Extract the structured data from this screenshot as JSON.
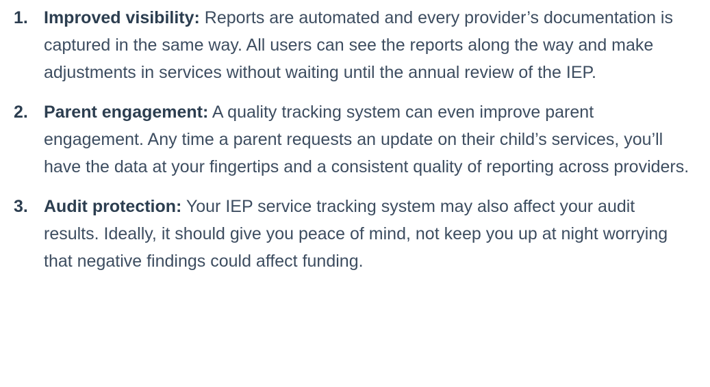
{
  "items": [
    {
      "number": "1.",
      "lead": "Improved visibility:",
      "body": "Reports are automated and every provider’s documentation is captured in the same way. All users can see the reports along the way and make adjustments in services without waiting until the annual review of the IEP."
    },
    {
      "number": "2.",
      "lead": "Parent engagement:",
      "body": "A quality tracking system can even improve parent engagement. Any time a parent requests an update on their child’s services, you’ll have the data at your fingertips and a consistent quality of reporting across providers."
    },
    {
      "number": "3.",
      "lead": "Audit protection:",
      "body": "Your IEP service tracking system may also affect your audit results. Ideally, it should give you peace of mind, not keep you up at night worrying that negative findings could affect funding."
    }
  ]
}
